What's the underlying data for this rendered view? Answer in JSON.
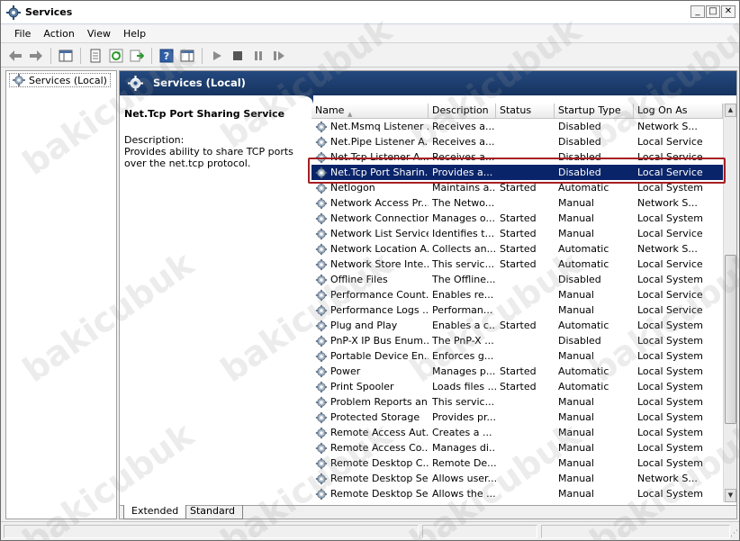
{
  "window": {
    "title": "Services"
  },
  "menu": [
    "File",
    "Action",
    "View",
    "Help"
  ],
  "tree": {
    "root_label": "Services (Local)"
  },
  "pane": {
    "header_title": "Services (Local)"
  },
  "details": {
    "service_name": "Net.Tcp Port Sharing Service",
    "description_label": "Description:",
    "description_text": "Provides ability to share TCP ports over the net.tcp protocol."
  },
  "columns": [
    "Name",
    "Description",
    "Status",
    "Startup Type",
    "Log On As"
  ],
  "rows": [
    {
      "name": "Net.Msmq Listener ...",
      "description": "Receives a...",
      "status": "",
      "startup": "Disabled",
      "logon": "Network S..."
    },
    {
      "name": "Net.Pipe Listener A...",
      "description": "Receives a...",
      "status": "",
      "startup": "Disabled",
      "logon": "Local Service"
    },
    {
      "name": "Net.Tcp Listener A...",
      "description": "Receives a...",
      "status": "",
      "startup": "Disabled",
      "logon": "Local Service"
    },
    {
      "name": "Net.Tcp Port Sharin...",
      "description": "Provides a...",
      "status": "",
      "startup": "Disabled",
      "logon": "Local Service",
      "selected": true
    },
    {
      "name": "Netlogon",
      "description": "Maintains a...",
      "status": "Started",
      "startup": "Automatic",
      "logon": "Local System"
    },
    {
      "name": "Network Access Pr...",
      "description": "The Netwo...",
      "status": "",
      "startup": "Manual",
      "logon": "Network S..."
    },
    {
      "name": "Network Connections",
      "description": "Manages o...",
      "status": "Started",
      "startup": "Manual",
      "logon": "Local System"
    },
    {
      "name": "Network List Service",
      "description": "Identifies t...",
      "status": "Started",
      "startup": "Manual",
      "logon": "Local Service"
    },
    {
      "name": "Network Location A...",
      "description": "Collects an...",
      "status": "Started",
      "startup": "Automatic",
      "logon": "Network S..."
    },
    {
      "name": "Network Store Inte...",
      "description": "This servic...",
      "status": "Started",
      "startup": "Automatic",
      "logon": "Local Service"
    },
    {
      "name": "Offline Files",
      "description": "The Offline...",
      "status": "",
      "startup": "Disabled",
      "logon": "Local System"
    },
    {
      "name": "Performance Count...",
      "description": "Enables re...",
      "status": "",
      "startup": "Manual",
      "logon": "Local Service"
    },
    {
      "name": "Performance Logs ...",
      "description": "Performan...",
      "status": "",
      "startup": "Manual",
      "logon": "Local Service"
    },
    {
      "name": "Plug and Play",
      "description": "Enables a c...",
      "status": "Started",
      "startup": "Automatic",
      "logon": "Local System"
    },
    {
      "name": "PnP-X IP Bus Enum...",
      "description": "The PnP-X ...",
      "status": "",
      "startup": "Disabled",
      "logon": "Local System"
    },
    {
      "name": "Portable Device En...",
      "description": "Enforces g...",
      "status": "",
      "startup": "Manual",
      "logon": "Local System"
    },
    {
      "name": "Power",
      "description": "Manages p...",
      "status": "Started",
      "startup": "Automatic",
      "logon": "Local System"
    },
    {
      "name": "Print Spooler",
      "description": "Loads files ...",
      "status": "Started",
      "startup": "Automatic",
      "logon": "Local System"
    },
    {
      "name": "Problem Reports an...",
      "description": "This servic...",
      "status": "",
      "startup": "Manual",
      "logon": "Local System"
    },
    {
      "name": "Protected Storage",
      "description": "Provides pr...",
      "status": "",
      "startup": "Manual",
      "logon": "Local System"
    },
    {
      "name": "Remote Access Aut...",
      "description": "Creates a ...",
      "status": "",
      "startup": "Manual",
      "logon": "Local System"
    },
    {
      "name": "Remote Access Co...",
      "description": "Manages di...",
      "status": "",
      "startup": "Manual",
      "logon": "Local System"
    },
    {
      "name": "Remote Desktop C...",
      "description": "Remote De...",
      "status": "",
      "startup": "Manual",
      "logon": "Local System"
    },
    {
      "name": "Remote Desktop Se...",
      "description": "Allows user...",
      "status": "",
      "startup": "Manual",
      "logon": "Network S..."
    },
    {
      "name": "Remote Desktop Se...",
      "description": "Allows the ...",
      "status": "",
      "startup": "Manual",
      "logon": "Local System"
    }
  ],
  "tabs": {
    "extended": "Extended",
    "standard": "Standard"
  },
  "watermark": "bakicubuk",
  "colors": {
    "header_bg": "#1b3a6b",
    "selection": "#0a246a",
    "highlight_box": "#a61f23"
  }
}
